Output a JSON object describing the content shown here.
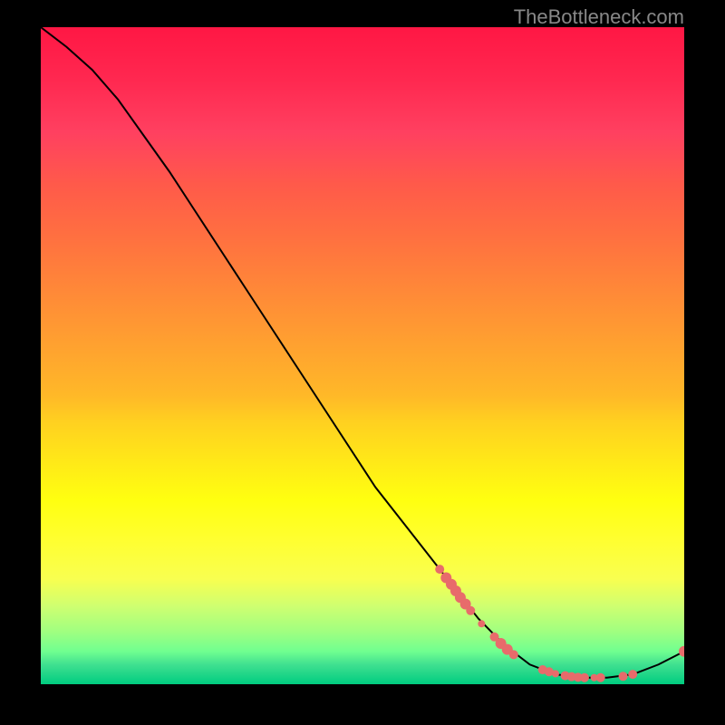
{
  "watermark": "TheBottleneck.com",
  "chart_data": {
    "type": "line",
    "title": "",
    "xlabel": "",
    "ylabel": "",
    "xlim": [
      0,
      100
    ],
    "ylim": [
      0,
      100
    ],
    "grid": false,
    "curve": [
      {
        "x": 0,
        "y": 100
      },
      {
        "x": 4,
        "y": 97
      },
      {
        "x": 8,
        "y": 93.5
      },
      {
        "x": 12,
        "y": 89
      },
      {
        "x": 16,
        "y": 83.5
      },
      {
        "x": 20,
        "y": 78
      },
      {
        "x": 24,
        "y": 72
      },
      {
        "x": 28,
        "y": 66
      },
      {
        "x": 32,
        "y": 60
      },
      {
        "x": 36,
        "y": 54
      },
      {
        "x": 40,
        "y": 48
      },
      {
        "x": 44,
        "y": 42
      },
      {
        "x": 48,
        "y": 36
      },
      {
        "x": 52,
        "y": 30
      },
      {
        "x": 56,
        "y": 25
      },
      {
        "x": 60,
        "y": 20
      },
      {
        "x": 64,
        "y": 15
      },
      {
        "x": 68,
        "y": 10
      },
      {
        "x": 72,
        "y": 6
      },
      {
        "x": 76,
        "y": 3
      },
      {
        "x": 80,
        "y": 1.5
      },
      {
        "x": 84,
        "y": 1
      },
      {
        "x": 88,
        "y": 1
      },
      {
        "x": 92,
        "y": 1.5
      },
      {
        "x": 96,
        "y": 3
      },
      {
        "x": 100,
        "y": 5
      }
    ],
    "markers": [
      {
        "x": 62,
        "y": 17.5
      },
      {
        "x": 63,
        "y": 16.2
      },
      {
        "x": 63.8,
        "y": 15.2
      },
      {
        "x": 64.5,
        "y": 14.2
      },
      {
        "x": 65.2,
        "y": 13.2
      },
      {
        "x": 66,
        "y": 12.2
      },
      {
        "x": 66.8,
        "y": 11.2
      },
      {
        "x": 68.5,
        "y": 9.2
      },
      {
        "x": 70.5,
        "y": 7.2
      },
      {
        "x": 71.5,
        "y": 6.2
      },
      {
        "x": 72.5,
        "y": 5.3
      },
      {
        "x": 73.5,
        "y": 4.5
      },
      {
        "x": 78,
        "y": 2.2
      },
      {
        "x": 79,
        "y": 1.9
      },
      {
        "x": 80,
        "y": 1.6
      },
      {
        "x": 81.5,
        "y": 1.3
      },
      {
        "x": 82.5,
        "y": 1.15
      },
      {
        "x": 83.5,
        "y": 1.05
      },
      {
        "x": 84.5,
        "y": 1.0
      },
      {
        "x": 86,
        "y": 1.0
      },
      {
        "x": 87,
        "y": 1.0
      },
      {
        "x": 90.5,
        "y": 1.2
      },
      {
        "x": 92,
        "y": 1.5
      },
      {
        "x": 100,
        "y": 5
      }
    ],
    "marker_sizes": {
      "62": 5,
      "63": 6,
      "63.8": 6,
      "64.5": 6,
      "65.2": 6,
      "66": 6,
      "66.8": 5,
      "68.5": 4,
      "70.5": 5,
      "71.5": 6,
      "72.5": 6,
      "73.5": 5,
      "78": 5,
      "79": 5,
      "80": 4,
      "81.5": 5,
      "82.5": 5,
      "83.5": 5,
      "84.5": 5,
      "86": 4,
      "87": 5,
      "90.5": 5,
      "92": 5,
      "100": 6
    },
    "colors": {
      "curve": "#000000",
      "marker": "#e86b6b",
      "gradient_top": "#ff1744",
      "gradient_mid": "#ffff10",
      "gradient_bottom": "#00cc80"
    }
  }
}
